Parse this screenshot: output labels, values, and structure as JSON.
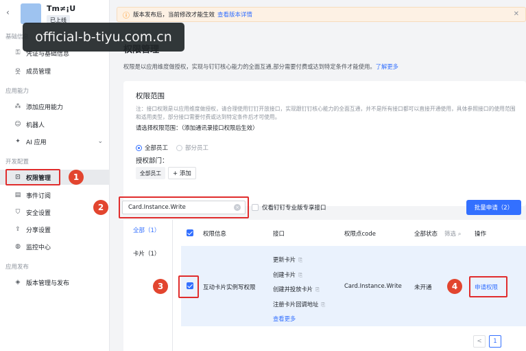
{
  "sidebar": {
    "back_icon": "chevron-left-icon",
    "app_name": "Tm≠¡U",
    "app_status": "已上线",
    "groups": {
      "basic": "基础信息",
      "capability": "应用能力",
      "dev": "开发配置",
      "release": "应用发布"
    },
    "items": [
      {
        "label": "凭证与基础信息",
        "icon": "key-icon"
      },
      {
        "label": "成员管理",
        "icon": "person-icon"
      },
      {
        "label": "添加应用能力",
        "icon": "apps-icon"
      },
      {
        "label": "机器人",
        "icon": "robot-icon"
      },
      {
        "label": "AI 应用",
        "icon": "ai-icon"
      },
      {
        "label": "权限管理",
        "icon": "lock-icon"
      },
      {
        "label": "事件订阅",
        "icon": "event-icon"
      },
      {
        "label": "安全设置",
        "icon": "shield-icon"
      },
      {
        "label": "分享设置",
        "icon": "share-icon"
      },
      {
        "label": "监控中心",
        "icon": "monitor-icon"
      },
      {
        "label": "版本管理与发布",
        "icon": "version-icon"
      }
    ]
  },
  "watermark": "official-b-tiyu.com.cn",
  "banner": {
    "text": "版本发布后，当前修改才能生效",
    "link": "查看版本详情"
  },
  "page": {
    "title": "权限管理",
    "desc": "权限是以应用维度做授权，实现与钉钉核心能力的全面互通,部分需要付费或达到特定条件才能使用。",
    "desc_link": "了解更多"
  },
  "scope": {
    "title": "权限范围",
    "note": "注：接口权限是以应用维度做授权，请合理使用钉钉开放接口，实现跟钉钉核心能力的全面互通，并不是所有接口都可以直接开通使用，具体参照接口的使用范围和适用类型，部分接口需要付费或达到特定条件后才可使用。",
    "select_label": "请选择权限范围：（添加通讯录接口权限后生效）",
    "radio_all": "全部员工",
    "radio_part": "部分员工",
    "dept_label": "授权部门：",
    "dept_tag": "全部员工",
    "dept_add": "+ 添加"
  },
  "search": {
    "value": "Card.Instance.Write",
    "pro_only_label": "仅看钉钉专业版专享接口",
    "bulk_button": "批量申请（2）"
  },
  "categories": [
    {
      "label": "全部（1）"
    },
    {
      "label": "卡片（1）"
    }
  ],
  "table": {
    "headers": [
      "权限信息",
      "接口",
      "权限点code",
      "全部状态",
      "筛选",
      "操作"
    ],
    "row": {
      "name": "互动卡片实例写权限",
      "interfaces": [
        "更新卡片",
        "创建卡片",
        "创建并投放卡片",
        "注册卡片回调地址"
      ],
      "more": "查看更多",
      "code": "Card.Instance.Write",
      "status": "未开通",
      "action": "申请权限"
    }
  },
  "pager": {
    "prev": "<",
    "current": "1"
  },
  "annotations": [
    "1",
    "2",
    "3",
    "4"
  ],
  "colors": {
    "accent": "#3370ff",
    "annotation": "#e02c2c"
  }
}
